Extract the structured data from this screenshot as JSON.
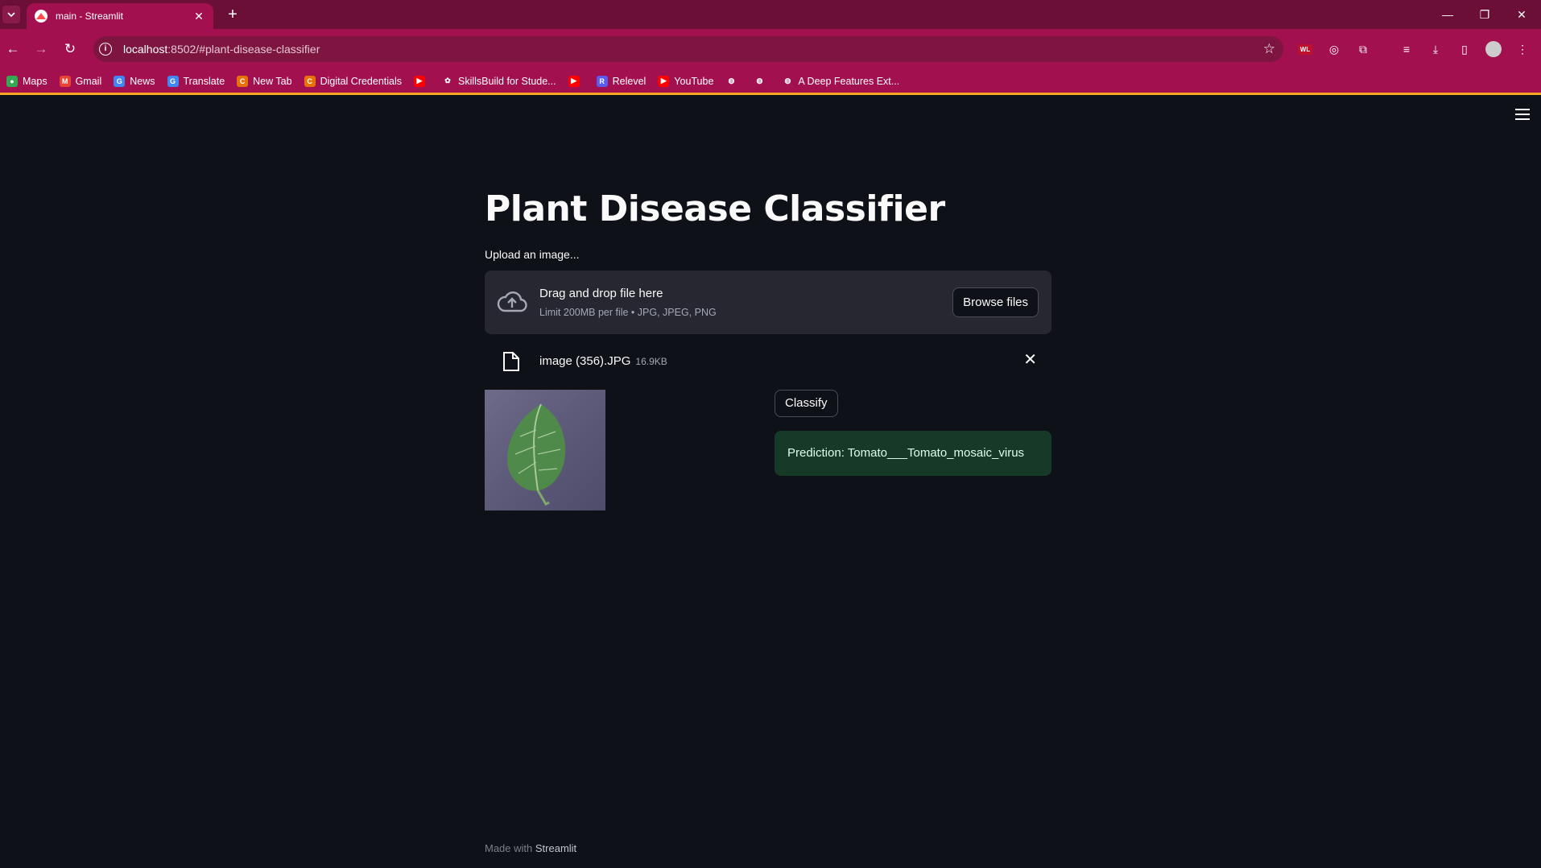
{
  "browser": {
    "tab_title": "main - Streamlit",
    "url_host": "localhost",
    "url_rest": ":8502/#plant-disease-classifier",
    "bookmarks": [
      {
        "label": "Maps",
        "color": "#34a853",
        "glyph": "●"
      },
      {
        "label": "Gmail",
        "color": "#ea4335",
        "glyph": "M"
      },
      {
        "label": "News",
        "color": "#4285f4",
        "glyph": "G"
      },
      {
        "label": "Translate",
        "color": "#4285f4",
        "glyph": "G"
      },
      {
        "label": "New Tab",
        "color": "#e8710a",
        "glyph": "C"
      },
      {
        "label": "Digital Credentials",
        "color": "#e8710a",
        "glyph": "C"
      },
      {
        "label": "",
        "color": "#ff0000",
        "glyph": "▶"
      },
      {
        "label": "SkillsBuild for Stude...",
        "color": "#ffffff",
        "glyph": "✿"
      },
      {
        "label": "",
        "color": "#ff0000",
        "glyph": "▶"
      },
      {
        "label": "Relevel",
        "color": "#5b5bf0",
        "glyph": "R"
      },
      {
        "label": "YouTube",
        "color": "#ff0000",
        "glyph": "▶"
      },
      {
        "label": "",
        "color": "#ffffff",
        "glyph": "◍"
      },
      {
        "label": "",
        "color": "#ffffff",
        "glyph": "◍"
      },
      {
        "label": "A Deep Features Ext...",
        "color": "#ffffff",
        "glyph": "◍"
      }
    ]
  },
  "app": {
    "title": "Plant Disease Classifier",
    "upload_label": "Upload an image...",
    "dropzone": {
      "title": "Drag and drop file here",
      "subtitle": "Limit 200MB per file • JPG, JPEG, PNG",
      "browse_label": "Browse files"
    },
    "file": {
      "name": "image (356).JPG",
      "size": "16.9KB"
    },
    "classify_label": "Classify",
    "prediction": "Prediction: Tomato___Tomato_mosaic_virus"
  },
  "footer": {
    "prefix": "Made with",
    "brand": "Streamlit"
  },
  "colors": {
    "page_bg": "#0e1117",
    "chrome": "#a3104f",
    "success_bg": "#173928"
  }
}
